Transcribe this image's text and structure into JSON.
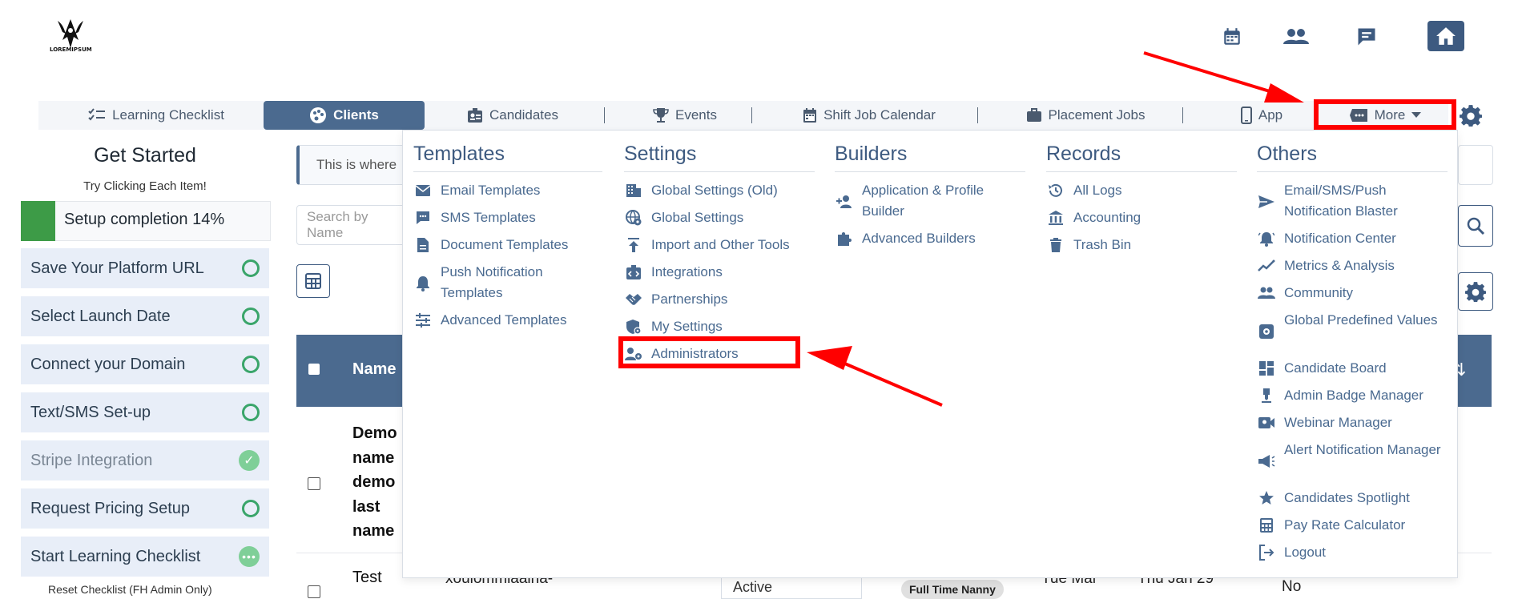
{
  "logo": {
    "text": "LOREMIPSUM"
  },
  "header_icons": [
    "calendar-icon",
    "people-icon",
    "chat-icon",
    "home-icon"
  ],
  "tabs": [
    {
      "label": "Learning Checklist",
      "icon": "checklist-icon"
    },
    {
      "label": "Clients",
      "icon": "palette-icon",
      "active": true
    },
    {
      "label": "Candidates",
      "icon": "badge-icon"
    },
    {
      "label": "Events",
      "icon": "trophy-icon"
    },
    {
      "label": "Shift Job Calendar",
      "icon": "calendar-icon"
    },
    {
      "label": "Placement Jobs",
      "icon": "briefcase-icon"
    },
    {
      "label": "App",
      "icon": "phone-icon"
    },
    {
      "label": "More",
      "icon": "ticket-icon"
    }
  ],
  "sidebar": {
    "title": "Get Started",
    "subtitle": "Try Clicking Each Item!",
    "progress_label": "Setup completion 14%",
    "progress": 0.14,
    "items": [
      {
        "label": "Save Your Platform URL",
        "state": "open"
      },
      {
        "label": "Select Launch Date",
        "state": "open"
      },
      {
        "label": "Connect your Domain",
        "state": "open"
      },
      {
        "label": "Text/SMS Set-up",
        "state": "open"
      },
      {
        "label": "Stripe Integration",
        "state": "done"
      },
      {
        "label": "Request Pricing Setup",
        "state": "open"
      },
      {
        "label": "Start Learning Checklist",
        "state": "progress"
      }
    ],
    "footer": "Reset Checklist (FH Admin Only)"
  },
  "content": {
    "info_text": "This is where",
    "search_placeholder": "Search by Name",
    "table_header_name": "Name",
    "row1_name": "Demo name demo last name",
    "row2_name": "Test",
    "row2_email": "xoulommiaaina-",
    "row2_status": "Active",
    "row2_badge": "Full Time Nanny",
    "row2_date1": "Tue Mar",
    "row2_date2": "Thu Jan 29",
    "row2_flag": "No"
  },
  "menu": {
    "columns": [
      {
        "title": "Templates",
        "items": [
          {
            "label": "Email Templates",
            "icon": "envelope-icon"
          },
          {
            "label": "SMS Templates",
            "icon": "sms-icon"
          },
          {
            "label": "Document Templates",
            "icon": "document-icon"
          },
          {
            "label": "Push Notification Templates",
            "icon": "bell-icon"
          },
          {
            "label": "Advanced Templates",
            "icon": "sliders-icon"
          }
        ]
      },
      {
        "title": "Settings",
        "items": [
          {
            "label": "Global Settings (Old)",
            "icon": "building-icon"
          },
          {
            "label": "Global Settings",
            "icon": "globe-gear-icon"
          },
          {
            "label": "Import and Other Tools",
            "icon": "upload-icon"
          },
          {
            "label": "Integrations",
            "icon": "code-box-icon"
          },
          {
            "label": "Partnerships",
            "icon": "handshake-icon"
          },
          {
            "label": "My Settings",
            "icon": "user-shield-icon"
          },
          {
            "label": "Administrators",
            "icon": "user-gear-icon"
          }
        ]
      },
      {
        "title": "Builders",
        "items": [
          {
            "label": "Application & Profile Builder",
            "icon": "user-plus-icon"
          },
          {
            "label": "Advanced Builders",
            "icon": "puzzle-icon"
          }
        ]
      },
      {
        "title": "Records",
        "items": [
          {
            "label": "All Logs",
            "icon": "history-icon"
          },
          {
            "label": "Accounting",
            "icon": "bank-icon"
          },
          {
            "label": "Trash Bin",
            "icon": "trash-icon"
          }
        ]
      },
      {
        "title": "Others",
        "items": [
          {
            "label": "Email/SMS/Push Notification Blaster",
            "icon": "send-icon"
          },
          {
            "label": "Notification Center",
            "icon": "bell-ring-icon"
          },
          {
            "label": "Metrics & Analysis",
            "icon": "chart-line-icon"
          },
          {
            "label": "Community",
            "icon": "people-icon"
          },
          {
            "label": "Global Predefined Values",
            "icon": "gear-box-icon"
          },
          {
            "label": "Candidate Board",
            "icon": "dashboard-icon"
          },
          {
            "label": "Admin Badge Manager",
            "icon": "medal-icon"
          },
          {
            "label": "Webinar Manager",
            "icon": "video-icon"
          },
          {
            "label": "Alert Notification Manager",
            "icon": "megaphone-icon"
          },
          {
            "label": "Candidates Spotlight",
            "icon": "star-icon"
          },
          {
            "label": "Pay Rate Calculator",
            "icon": "calculator-icon"
          },
          {
            "label": "Logout",
            "icon": "logout-icon"
          }
        ]
      }
    ]
  },
  "colors": {
    "primary": "#3d5a80",
    "accent": "#4b6a8f",
    "success": "#3d9b47",
    "annotation": "#ff0000",
    "menu_text": "#4a6a90"
  }
}
